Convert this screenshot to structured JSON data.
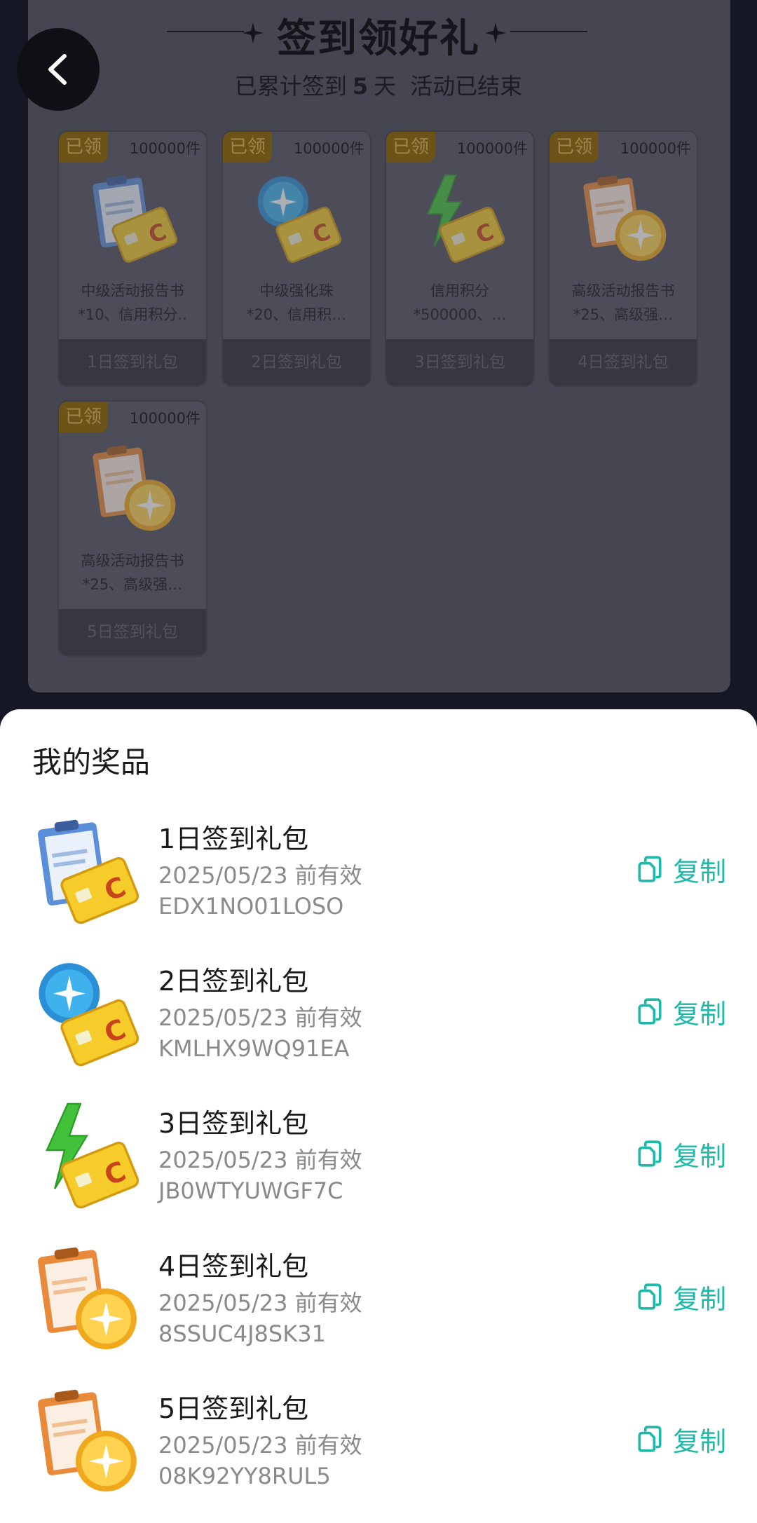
{
  "header": {
    "title": "签到领好礼",
    "subtitle_prefix": "已累计签到",
    "days": "5",
    "subtitle_unit": "天",
    "status": "活动已结束"
  },
  "gifts": [
    {
      "tag": "已领",
      "qty": "100000件",
      "desc1": "中级活动报告书",
      "desc2": "*10、信用积分..",
      "footer": "1日签到礼包",
      "icon": "report-clipboard-with-card"
    },
    {
      "tag": "已领",
      "qty": "100000件",
      "desc1": "中级强化珠",
      "desc2": "*20、信用积…",
      "footer": "2日签到礼包",
      "icon": "blue-orb-with-card"
    },
    {
      "tag": "已领",
      "qty": "100000件",
      "desc1": "信用积分",
      "desc2": "*500000、…",
      "footer": "3日签到礼包",
      "icon": "lightning-with-card"
    },
    {
      "tag": "已领",
      "qty": "100000件",
      "desc1": "高级活动报告书",
      "desc2": "*25、高级强…",
      "footer": "4日签到礼包",
      "icon": "orange-report-with-gold-orb"
    },
    {
      "tag": "已领",
      "qty": "100000件",
      "desc1": "高级活动报告书",
      "desc2": "*25、高级强…",
      "footer": "5日签到礼包",
      "icon": "orange-report-with-gold-orb"
    }
  ],
  "sheet": {
    "title": "我的奖品",
    "copy_label": "复制",
    "prizes": [
      {
        "name": "1日签到礼包",
        "valid": "2025/05/23 前有效",
        "code": "EDX1NO01LOSO",
        "icon": "report-clipboard-with-card"
      },
      {
        "name": "2日签到礼包",
        "valid": "2025/05/23 前有效",
        "code": "KMLHX9WQ91EA",
        "icon": "blue-orb-with-card"
      },
      {
        "name": "3日签到礼包",
        "valid": "2025/05/23 前有效",
        "code": "JB0WTYUWGF7C",
        "icon": "lightning-with-card"
      },
      {
        "name": "4日签到礼包",
        "valid": "2025/05/23 前有效",
        "code": "8SSUC4J8SK31",
        "icon": "orange-report-with-gold-orb"
      },
      {
        "name": "5日签到礼包",
        "valid": "2025/05/23 前有效",
        "code": "08K92YY8RUL5",
        "icon": "orange-report-with-gold-orb"
      }
    ]
  },
  "colors": {
    "accent": "#1fb9a9",
    "overlay": "#454652",
    "tag": "#6e5318"
  }
}
